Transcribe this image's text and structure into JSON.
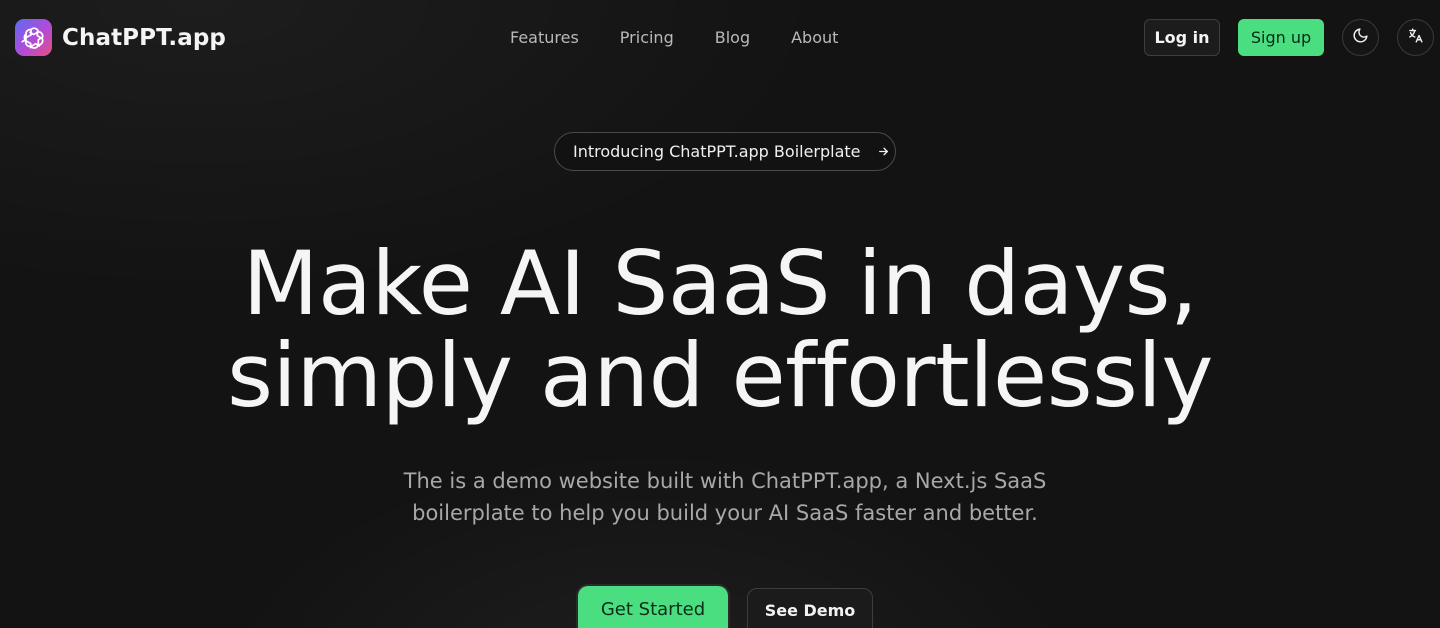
{
  "header": {
    "brand_name": "ChatPPT.app",
    "nav": [
      {
        "label": "Features"
      },
      {
        "label": "Pricing"
      },
      {
        "label": "Blog"
      },
      {
        "label": "About"
      }
    ],
    "login_label": "Log in",
    "signup_label": "Sign up"
  },
  "announcement": {
    "text": "Introducing ChatPPT.app Boilerplate"
  },
  "hero": {
    "headline_line1": "Make AI SaaS in days,",
    "headline_line2": "simply and effortlessly",
    "subtitle_line1": "The is a demo website built with ChatPPT.app, a Next.js SaaS",
    "subtitle_line2": "boilerplate to help you build your AI SaaS faster and better.",
    "primary_cta": "Get Started",
    "secondary_cta": "See Demo"
  },
  "colors": {
    "background": "#131313",
    "accent_green": "#4ade80",
    "logo_gradient_start": "#5b6cf0",
    "logo_gradient_end": "#e6507f"
  },
  "icons": {
    "logo": "openai-knot-icon",
    "theme_toggle": "moon-icon",
    "language": "translate-icon",
    "announcement_arrow": "arrow-right-icon"
  }
}
